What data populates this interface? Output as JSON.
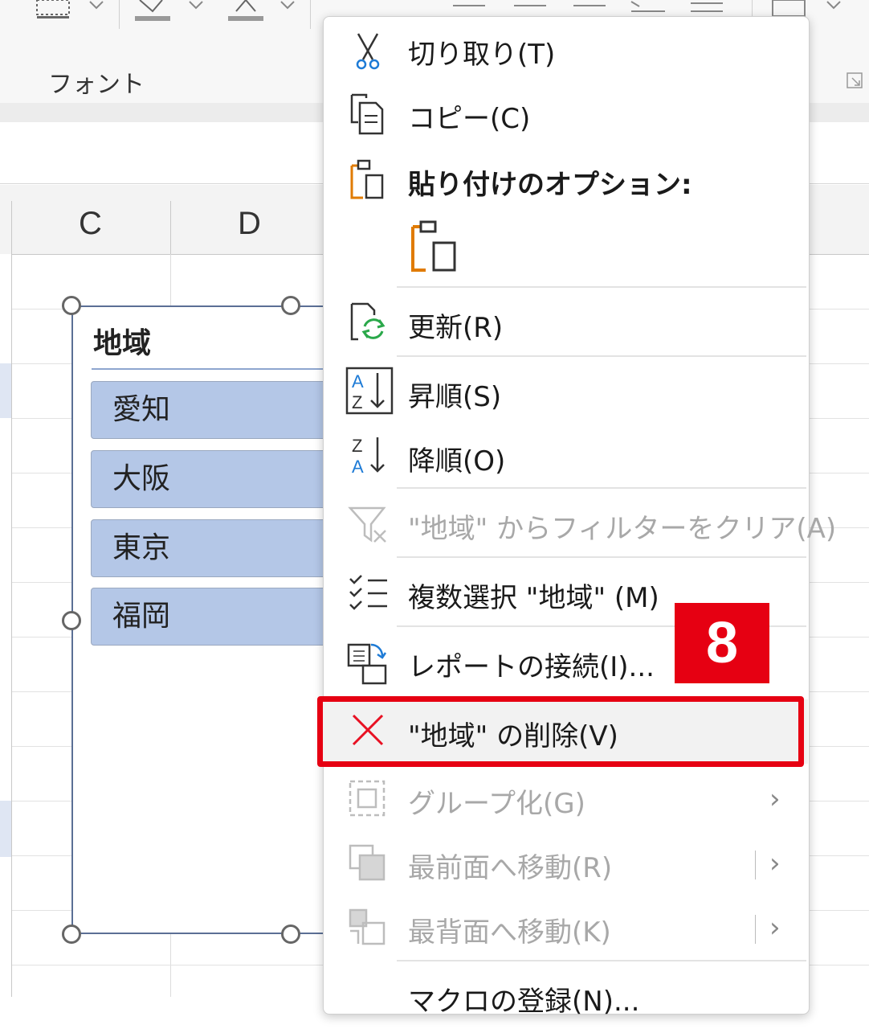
{
  "ribbon": {
    "group_label": "フォント"
  },
  "sheet": {
    "columns": [
      "C",
      "D"
    ]
  },
  "slicer": {
    "title": "地域",
    "items": [
      "愛知",
      "大阪",
      "東京",
      "福岡"
    ]
  },
  "context_menu": {
    "items": [
      {
        "label": "切り取り(T)",
        "icon": "scissors-icon",
        "enabled": true
      },
      {
        "label": "コピー(C)",
        "icon": "copy-icon",
        "enabled": true
      },
      {
        "label": "貼り付けのオプション:",
        "icon": "paste-icon",
        "enabled": true,
        "bold": true
      },
      {
        "label": "更新(R)",
        "icon": "refresh-icon",
        "enabled": true
      },
      {
        "label": "昇順(S)",
        "icon": "sort-ascending-icon",
        "enabled": true
      },
      {
        "label": "降順(O)",
        "icon": "sort-descending-icon",
        "enabled": true
      },
      {
        "label": "\"地域\" からフィルターをクリア(A)",
        "icon": "clear-filter-icon",
        "enabled": false
      },
      {
        "label": "複数選択 \"地域\" (M)",
        "icon": "multi-select-icon",
        "enabled": true
      },
      {
        "label": "レポートの接続(I)...",
        "icon": "report-connections-icon",
        "enabled": true
      },
      {
        "label": "\"地域\" の削除(V)",
        "icon": "delete-x-icon",
        "enabled": true,
        "highlighted": true
      },
      {
        "label": "グループ化(G)",
        "icon": "group-icon",
        "enabled": false,
        "submenu": true
      },
      {
        "label": "最前面へ移動(R)",
        "icon": "bring-to-front-icon",
        "enabled": false,
        "submenu": true
      },
      {
        "label": "最背面へ移動(K)",
        "icon": "send-to-back-icon",
        "enabled": false,
        "submenu": true
      },
      {
        "label": "マクロの登録(N)...",
        "icon": "assign-macro-icon",
        "enabled": true
      }
    ],
    "submenu_arrow": "›"
  },
  "annotation": {
    "step_number": "8",
    "color": "#e60012"
  },
  "colors": {
    "slicer_item": "#b4c7e7",
    "delete_icon": "#e81123",
    "paste_icon": "#e07b00",
    "refresh_icon": "#2aa84a",
    "sort_a": "#1e7bd6"
  }
}
